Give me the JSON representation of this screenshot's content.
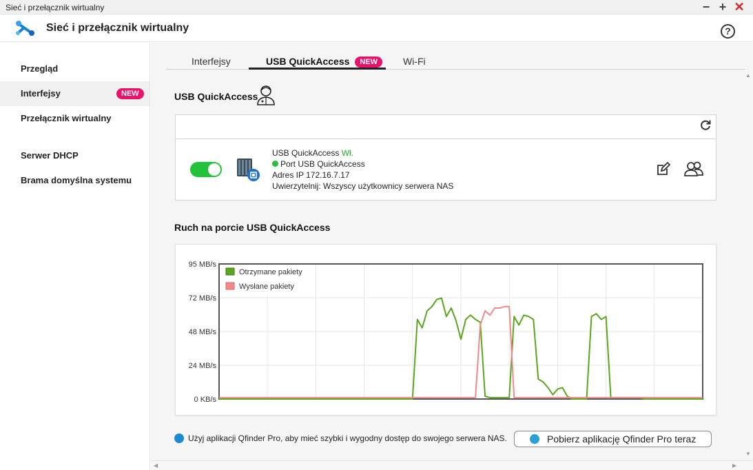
{
  "window": {
    "title": "Sieć i przełącznik wirtualny",
    "minimize": "−",
    "maximize": "+",
    "close": "✕"
  },
  "header": {
    "app_title": "Sieć i przełącznik wirtualny",
    "help": "?"
  },
  "sidebar": {
    "items": [
      {
        "label": "Przegląd"
      },
      {
        "label": "Interfejsy",
        "badge": "NEW"
      },
      {
        "label": "Przełącznik wirtualny"
      },
      {
        "label": "Serwer DHCP"
      },
      {
        "label": "Brama domyślna systemu"
      }
    ]
  },
  "tabs": [
    {
      "label": "Interfejsy"
    },
    {
      "label": "USB QuickAccess",
      "badge": "NEW"
    },
    {
      "label": "Wi-Fi"
    }
  ],
  "usb": {
    "section_title": "USB QuickAccess",
    "enabled": true,
    "status_prefix": "USB QuickAccess",
    "status_value": "Wł.",
    "port_label": "Port USB QuickAccess",
    "ip": "Adres IP 172.16.7.17",
    "auth": "Uwierzytelnij: Wszyscy użytkownicy serwera NAS"
  },
  "traffic": {
    "section_title": "Ruch na porcie USB QuickAccess"
  },
  "colors": {
    "accent_badge": "#e8126a",
    "toggle_on": "#23c23b",
    "received": "#5aa51e",
    "sent": "#f08a8a"
  },
  "chart_data": {
    "type": "line",
    "ylabels": [
      "95 MB/s",
      "72 MB/s",
      "48 MB/s",
      "24 MB/s",
      "0 KB/s"
    ],
    "ylim": [
      0,
      95
    ],
    "x": [
      0,
      1,
      2,
      3,
      4,
      5,
      6,
      7,
      8,
      9,
      10,
      11,
      12,
      13,
      14,
      15,
      16,
      17,
      18,
      19,
      20,
      21,
      22,
      23,
      24,
      25,
      26,
      27,
      28,
      29,
      30,
      31,
      32,
      33,
      34,
      35,
      36,
      37,
      38,
      39,
      40,
      41,
      42,
      43,
      44,
      45,
      46,
      47,
      48,
      49,
      50,
      51,
      52,
      53,
      54,
      55,
      56,
      57,
      58,
      59,
      60,
      61,
      62,
      63,
      64,
      65,
      66,
      67,
      68,
      69,
      70,
      71,
      72,
      73,
      74,
      75,
      76,
      77,
      78,
      79,
      80,
      81,
      82,
      83,
      84,
      85,
      86,
      87,
      88,
      89,
      90,
      91,
      92,
      93,
      94,
      95,
      96,
      97,
      98,
      99,
      100
    ],
    "series": [
      {
        "name": "Otrzymane pakiety",
        "values": [
          0,
          0,
          0,
          0,
          0,
          0,
          0,
          0,
          0,
          0,
          0,
          0,
          0,
          0,
          0,
          0,
          0,
          0,
          0,
          0,
          0,
          0,
          0,
          0,
          0,
          0,
          0,
          0,
          0,
          0,
          0,
          0,
          0,
          0,
          0,
          0,
          0,
          0,
          0,
          0,
          0,
          56,
          50,
          62,
          65,
          70,
          71,
          58,
          64,
          55,
          42,
          56,
          59,
          56,
          54,
          2,
          1,
          1,
          1,
          1,
          1,
          58,
          52,
          59,
          58,
          56,
          14,
          12,
          8,
          3,
          7,
          8,
          2,
          0,
          0,
          0,
          0,
          58,
          60,
          56,
          58,
          1,
          1,
          1,
          1,
          1,
          1,
          1,
          0,
          0,
          0,
          0,
          0,
          0,
          0,
          0,
          0,
          0,
          0,
          0,
          0
        ]
      },
      {
        "name": "Wysłane pakiety",
        "values": [
          1,
          1,
          1,
          1,
          1,
          1,
          1,
          1,
          1,
          1,
          1,
          1,
          1,
          1,
          1,
          1,
          1,
          1,
          1,
          1,
          1,
          1,
          1,
          1,
          1,
          1,
          1,
          1,
          1,
          1,
          1,
          1,
          1,
          1,
          1,
          1,
          1,
          1,
          1,
          1,
          1,
          1,
          1,
          1,
          1,
          1,
          1,
          1,
          1,
          1,
          1,
          1,
          1,
          1,
          52,
          62,
          59,
          64,
          64,
          65,
          65,
          1,
          1,
          1,
          1,
          1,
          1,
          1,
          1,
          1,
          1,
          1,
          1,
          1,
          1,
          1,
          1,
          1,
          1,
          1,
          1,
          1,
          1,
          1,
          1,
          1,
          1,
          1,
          1,
          1,
          1,
          1,
          1,
          1,
          1,
          1,
          1,
          1,
          1,
          1,
          1
        ]
      }
    ],
    "legend_position": "top-left",
    "grid": true
  }
}
